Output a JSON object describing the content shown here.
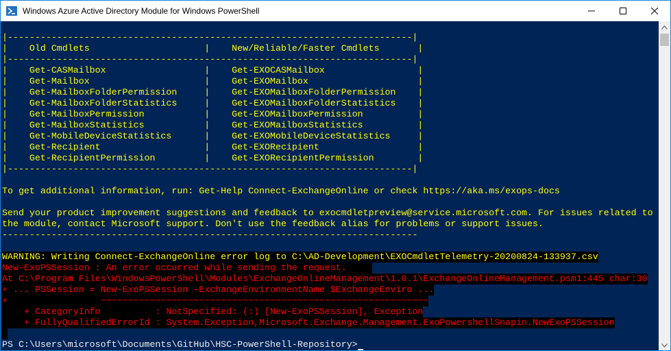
{
  "window": {
    "title": "Windows Azure Active Directory Module for Windows PowerShell",
    "icon": "powershell-icon",
    "buttons": [
      "minimize-icon",
      "maximize-icon",
      "close-icon"
    ]
  },
  "colors": {
    "console_bg": "#012456",
    "table_text": "#fffd00",
    "text": "#eeedf0",
    "warning": "#ffff00",
    "error": "#ff0000"
  },
  "table": {
    "border": "|--------------------------------------------------------------------------|",
    "headers": {
      "old": "|    Old Cmdlets                     |    New/Reliable/Faster Cmdlets       |"
    },
    "rows": [
      "|    Get-CASMailbox                  |    Get-EXOCASMailbox                 |",
      "|    Get-Mailbox                     |    Get-EXOMailbox                    |",
      "|    Get-MailboxFolderPermission     |    Get-EXOMailboxFolderPermission    |",
      "|    Get-MailboxFolderStatistics     |    Get-EXOMailboxFolderStatistics    |",
      "|    Get-MailboxPermission           |    Get-EXOMailboxPermission          |",
      "|    Get-MailboxStatistics           |    Get-EXOMailboxStatistics          |",
      "|    Get-MobileDeviceStatistics      |    Get-EXOMobileDeviceStatistics     |",
      "|    Get-Recipient                   |    Get-EXORecipient                  |",
      "|    Get-RecipientPermission         |    Get-EXORecipientPermission        |"
    ]
  },
  "info": {
    "help_line": "To get additional information, run: Get-Help Connect-ExchangeOnline or check https://aka.ms/exops-docs",
    "feedback_line1": "Send your product improvement suggestions and feedback to exocmdletpreview@service.microsoft.com. For issues related to",
    "feedback_line2": "the module, contact Microsoft support. Don't use the feedback alias for problems or support issues.",
    "separator": "----------------------------------------------------------------------------"
  },
  "warning": "WARNING: Writing Connect-ExchangeOnline error log to C:\\AD-Development\\EXOCmdletTelemetry-20200824-133937.csv",
  "error": {
    "line1": "New-ExoPSSession : An error occurred while sending the request.",
    "line2": "At C:\\Program Files\\WindowsPowerShell\\Modules\\ExchangeOnlineManagement\\1.0.1\\ExchangeOnlineManagement.psm1:445 char:30",
    "line3": "+ ... PSSession = New-ExoPSSession -ExchangeEnvironmentName $ExchangeEnviro ...",
    "line4": "+                 ~~~~~~~~~~~~~~~~~~~~~~~~~~~~~~~~~~~~~~~~~~~~~~~~~~~~~~~~~~~~",
    "line5": "    + CategoryInfo          : NotSpecified: (:) [New-ExoPSSession], Exception",
    "line6": "    + FullyQualifiedErrorId : System.Exception,Microsoft.Exchange.Management.ExoPowershellSnapin.NewExoPSSession"
  },
  "prompt": "PS C:\\Users\\microsoft\\Documents\\GitHub\\HSC-PowerShell-Repository>"
}
